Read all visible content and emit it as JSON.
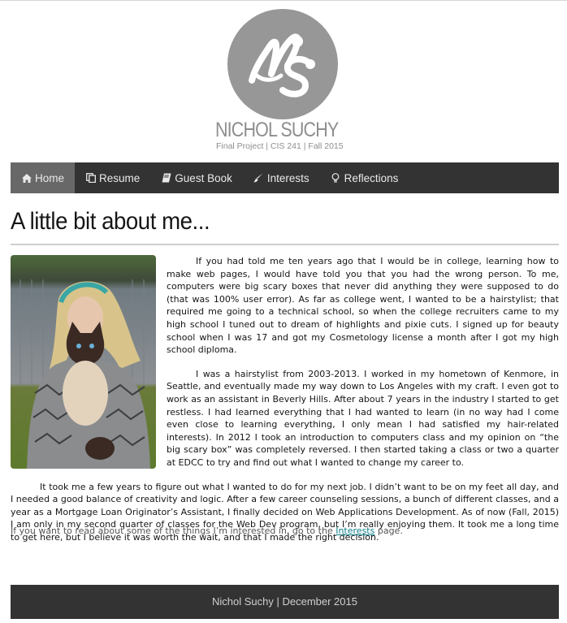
{
  "site": {
    "logo_monogram": "NS",
    "name": "NICHOL SUCHY",
    "subtitle": "Final Project | CIS 241 | Fall 2015"
  },
  "nav": {
    "items": [
      {
        "label": "Home",
        "icon": "home-icon",
        "active": true
      },
      {
        "label": "Resume",
        "icon": "copy-icon",
        "active": false
      },
      {
        "label": "Guest Book",
        "icon": "book-icon",
        "active": false
      },
      {
        "label": "Interests",
        "icon": "brush-icon",
        "active": false
      },
      {
        "label": "Reflections",
        "icon": "lightbulb-icon",
        "active": false
      }
    ]
  },
  "main": {
    "title": "A little bit about me...",
    "paragraphs": [
      "If you had told me ten years ago that I would be in college, learning how to make web pages, I would have told you that you had the wrong person. To me, computers were big scary boxes that never did anything they were supposed to do (that was 100% user error). As far as college went, I wanted to be a hairstylist; that required me going to a technical school, so when the college recruiters came to my high school I tuned out to dream of highlights and pixie cuts. I signed up for beauty school when I was 17 and got my Cosmetology license a month after I got my high school diploma.",
      "I was a hairstylist from 2003-2013. I worked in my hometown of Kenmore, in Seattle, and eventually made my way down to Los Angeles with my craft. I even got to work as an assistant in Beverly Hills. After about 7 years in the industry I started to get restless. I had learned everything that I had wanted to learn (in no way had I come even close to learning everything, I only mean I had satisfied my hair-related interests). In 2012 I took an introduction to computers class and my opinion on “the big scary box” was completely reversed. I then started taking a class or two a quarter at EDCC to try and find out what I wanted to change my career to.",
      "It took me a few years to figure out what I wanted to do for my next job. I didn’t want to be on my feet all day, and I needed a good balance of creativity and logic. After a few career counseling sessions, a bunch of different classes, and a year as a Mortgage Loan Originator’s Assistant, I finally decided on Web Applications Development. As of now (Fall, 2015) I am only in my second quarter of classes for the Web Dev program, but I’m really enjoying them. It took me a long time to get here, but I believe it was worth the wait, and that I made the right decision."
    ],
    "note_before": "If you want to read about some of the things I’m interested in, go to the ",
    "note_link": "Interests",
    "note_after": " page."
  },
  "footer": {
    "text": "Nichol Suchy | December 2015"
  },
  "colors": {
    "nav_bg": "#333333",
    "nav_active": "#686868",
    "logo_gray": "#979797",
    "link": "#0e7f8a"
  }
}
